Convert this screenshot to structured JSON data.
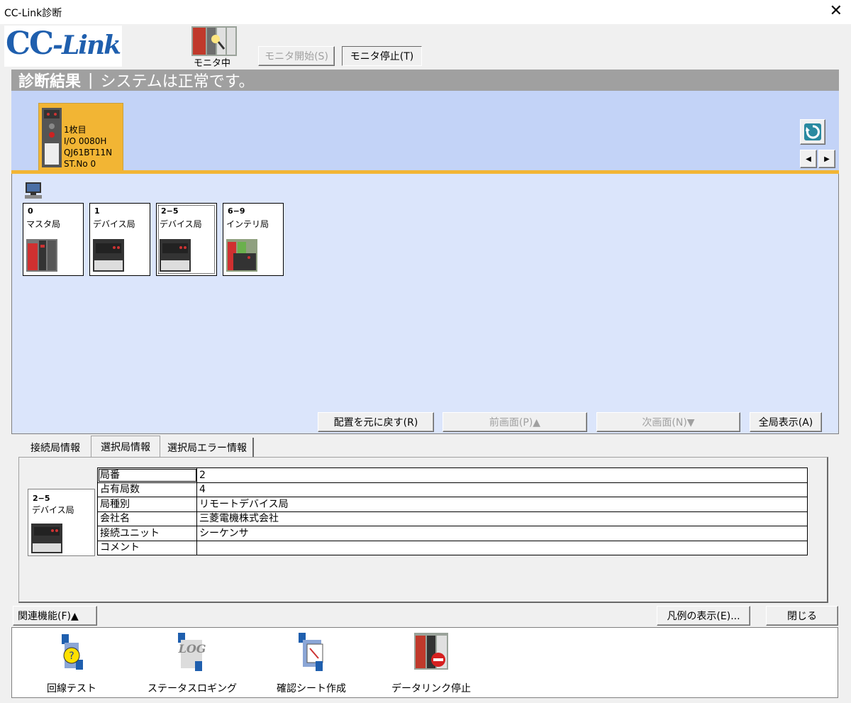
{
  "window": {
    "title": "CC-Link診断",
    "close_glyph": "✕"
  },
  "logo": {
    "text_cc": "CC",
    "text_link": "-Link"
  },
  "monitor": {
    "status_label": "モニタ中",
    "start_label": "モニタ開始(S)",
    "stop_label": "モニタ停止(T)"
  },
  "diagnosis": {
    "heading": "診断結果",
    "separator": "|",
    "message": "システムは正常です。"
  },
  "master_card": {
    "line1": "1枚目",
    "line2": "I/O 0080H",
    "line3": "QJ61BT11N",
    "line4": "ST.No 0"
  },
  "stations": [
    {
      "number": "0",
      "type": "マスタ局",
      "icon": "plc-master-icon"
    },
    {
      "number": "1",
      "type": "デバイス局",
      "icon": "remote-device-icon"
    },
    {
      "number": "2−5",
      "type": "デバイス局",
      "icon": "remote-device-icon"
    },
    {
      "number": "6−9",
      "type": "インテリ局",
      "icon": "intelligent-device-icon"
    }
  ],
  "layout_buttons": {
    "reset": "配置を元に戻す(R)",
    "prev": "前画面(P)▲",
    "next": "次画面(N)▼",
    "all": "全局表示(A)"
  },
  "tabs": [
    "接続局情報",
    "選択局情報",
    "選択局エラー情報"
  ],
  "selected_station": {
    "card_number": "2−5",
    "card_type": "デバイス局",
    "rows": [
      {
        "key": "局番",
        "value": "2"
      },
      {
        "key": "占有局数",
        "value": "4"
      },
      {
        "key": "局種別",
        "value": "リモートデバイス局"
      },
      {
        "key": "会社名",
        "value": "三菱電機株式会社"
      },
      {
        "key": "接続ユニット",
        "value": "シーケンサ"
      },
      {
        "key": "コメント",
        "value": ""
      }
    ]
  },
  "footer": {
    "related": "関連機能(F)▲",
    "legend": "凡例の表示(E)...",
    "close": "閉じる"
  },
  "functions": [
    {
      "label": "回線テスト",
      "icon": "line-test-icon"
    },
    {
      "label": "ステータスロギング",
      "icon": "status-logging-icon",
      "icon_text": "LOG"
    },
    {
      "label": "確認シート作成",
      "icon": "check-sheet-icon"
    },
    {
      "label": "データリンク停止",
      "icon": "data-link-stop-icon"
    }
  ],
  "colors": {
    "accent_orange": "#f2b534",
    "master_area": "#c3d3f7",
    "station_area": "#dbe5fb",
    "logo_blue": "#1f5fae"
  }
}
